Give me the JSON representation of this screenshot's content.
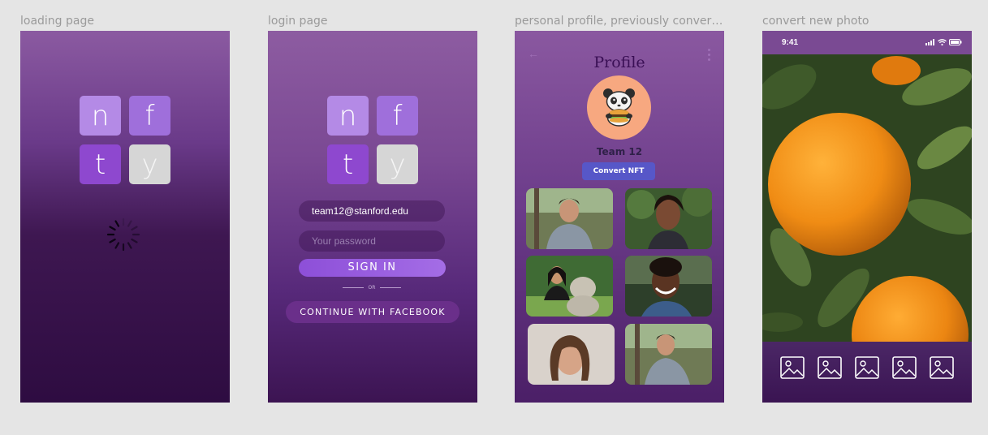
{
  "frames": {
    "loading": {
      "label": "loading page"
    },
    "login": {
      "label": "login page"
    },
    "profile": {
      "label": "personal profile, previously converte..."
    },
    "convert": {
      "label": "convert new photo"
    }
  },
  "logo": {
    "letters": [
      "n",
      "f",
      "t",
      "y"
    ]
  },
  "login": {
    "email_value": "team12@stanford.edu",
    "password_placeholder": "Your password",
    "signin_label": "SIGN IN",
    "or_label": "OR",
    "facebook_label": "CONTINUE WITH FACEBOOK"
  },
  "profile": {
    "title": "Profile",
    "name": "Team 12",
    "convert_label": "Convert NFT",
    "avatar_icon": "panda-burger-avatar",
    "photos_count": 6
  },
  "convert": {
    "time": "9:41",
    "image_icons": [
      "image-icon",
      "image-icon",
      "image-icon",
      "image-icon",
      "image-icon"
    ]
  },
  "colors": {
    "accent_purple": "#8e48cf",
    "signin_gradient_start": "#8d4fd8",
    "convert_button": "#5757c8",
    "avatar_bg": "#f7a880"
  }
}
